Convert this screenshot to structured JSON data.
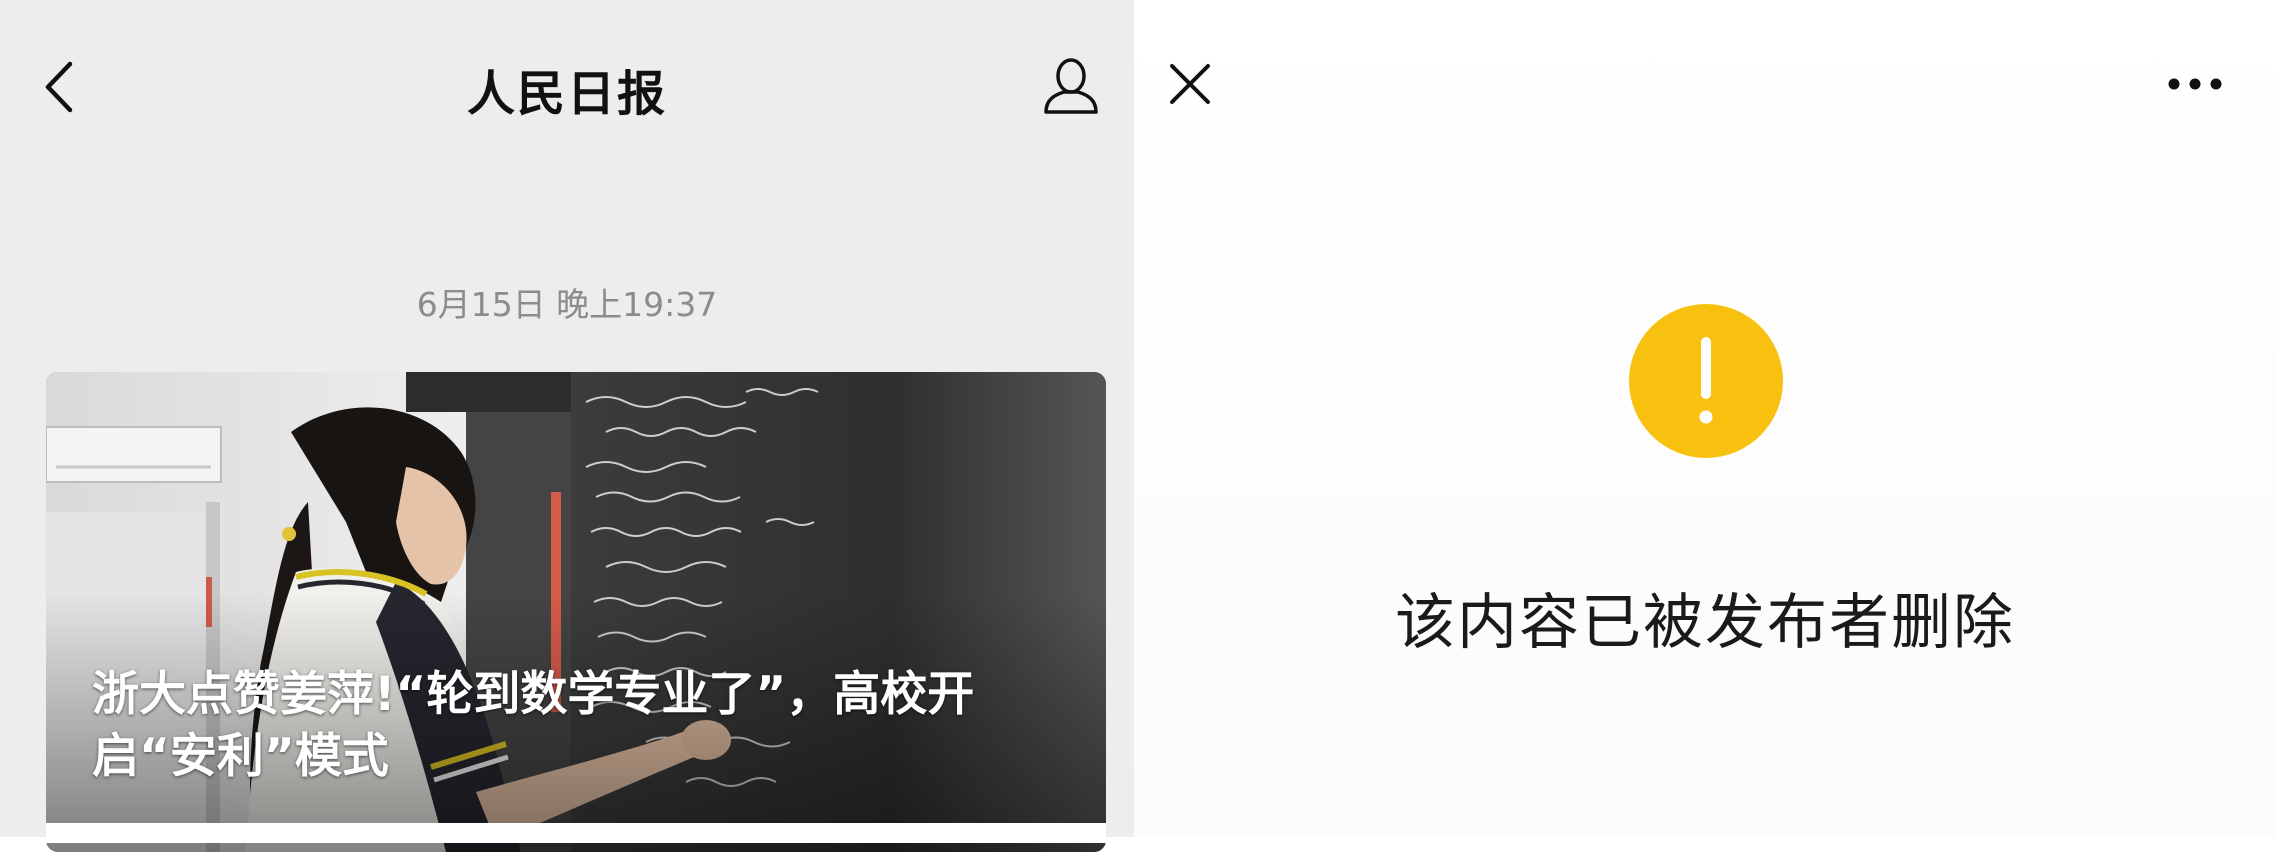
{
  "left": {
    "header": {
      "title": "人民日报",
      "back_icon": "chevron-left-icon",
      "profile_icon": "person-icon"
    },
    "timestamp": "6月15日 晚上19:37",
    "article": {
      "title": "浙大点赞姜萍!“轮到数学专业了”，高校开启“安利”模式"
    }
  },
  "right": {
    "header": {
      "close_icon": "close-icon",
      "more_icon": "more-dots-icon"
    },
    "notice": {
      "icon": "exclamation-icon",
      "icon_color": "#f9c10f",
      "message": "该内容已被发布者删除"
    }
  }
}
